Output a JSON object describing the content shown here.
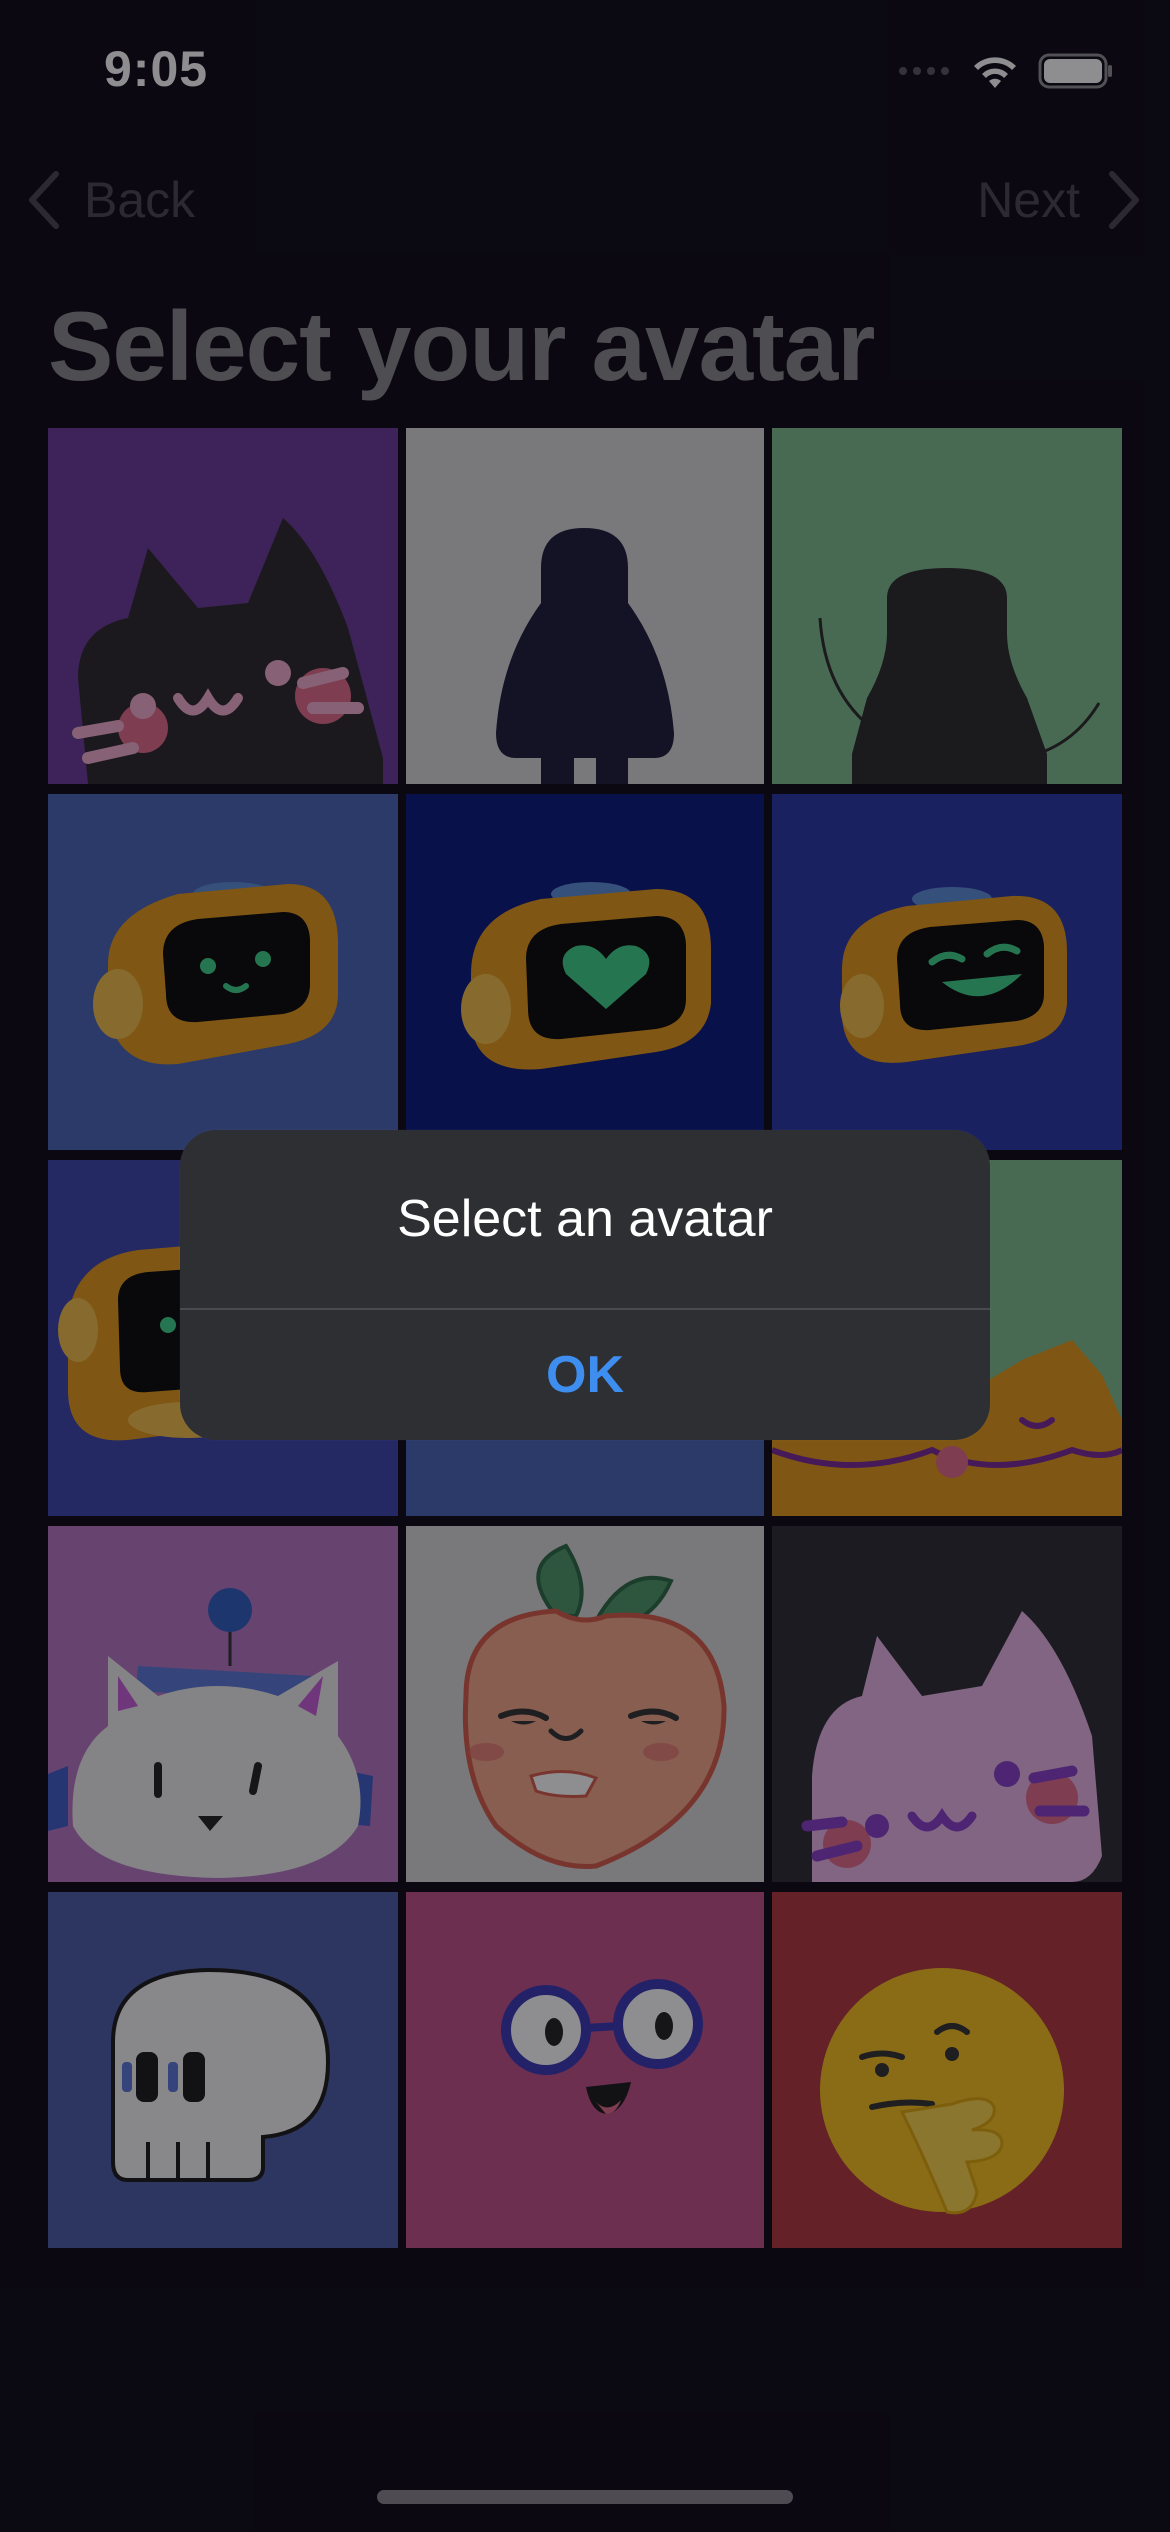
{
  "status_bar": {
    "time": "9:05",
    "icons": [
      "signal-dots-icon",
      "wifi-icon",
      "battery-icon"
    ]
  },
  "nav": {
    "back_label": "Back",
    "next_label": "Next"
  },
  "title": "Select your avatar",
  "avatars": [
    {
      "name": "black-cat",
      "bg": "#6a3c9a"
    },
    {
      "name": "silhouette-figure",
      "bg": "#d9d9d9"
    },
    {
      "name": "hooded-silhouette",
      "bg": "#7fbf8e"
    },
    {
      "name": "robot-smile",
      "bg": "#4a66b8"
    },
    {
      "name": "robot-heart",
      "bg": "#0a1a80"
    },
    {
      "name": "robot-laugh",
      "bg": "#2a38a8"
    },
    {
      "name": "robot-side",
      "bg": "#3b46ae"
    },
    {
      "name": "hidden-blue",
      "bg": "#4a66b8"
    },
    {
      "name": "orange-cat",
      "bg": "#7fbf8e"
    },
    {
      "name": "white-cat-hat",
      "bg": "#b777c4"
    },
    {
      "name": "peach-face",
      "bg": "#d9d9d9"
    },
    {
      "name": "pink-cat",
      "bg": "#2e2e35"
    },
    {
      "name": "skull",
      "bg": "#4a5fa6"
    },
    {
      "name": "glasses-face",
      "bg": "#c0528a"
    },
    {
      "name": "thinking-emoji",
      "bg": "#b4383f"
    }
  ],
  "alert": {
    "title": "Select an avatar",
    "button_label": "OK"
  },
  "colors": {
    "background": "#0e0b16",
    "alert_bg": "#2e2f33",
    "accent": "#3e8ef0"
  }
}
